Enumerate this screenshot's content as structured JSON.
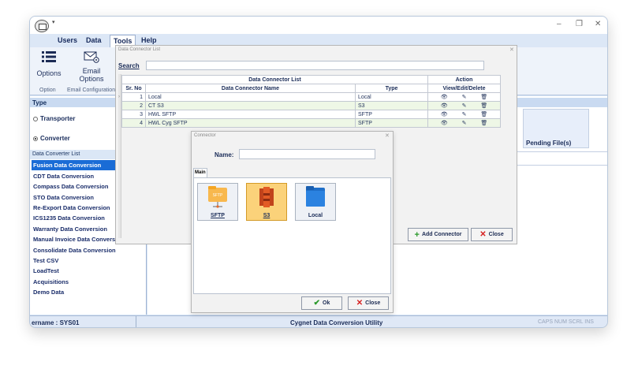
{
  "window": {
    "controls": [
      "–",
      "❐",
      "✕"
    ],
    "quick_access": "▾"
  },
  "menu": {
    "items": [
      "Users",
      "Data",
      "Tools",
      "Help"
    ],
    "active": "Tools"
  },
  "ribbon": {
    "options_label": "Options",
    "email_label_1": "Email",
    "email_label_2": "Options",
    "group_option": "Option",
    "group_email": "Email Configuration"
  },
  "left": {
    "type_header": "Type",
    "radio_transporter": "Transporter",
    "radio_converter": "Converter",
    "list_header": "Data Converter List",
    "items": [
      "Fusion Data Conversion",
      "CDT Data Conversion",
      "Compass Data Conversion",
      "STO Data Conversion",
      "Re-Export Data Conversion",
      "ICS1235 Data Conversion",
      "Warranty Data Conversion",
      "Manual Invoice Data Conversion",
      "Consolidate Data Conversion",
      "Test CSV",
      "LoadTest",
      "Acquisitions",
      "Demo Data"
    ]
  },
  "right": {
    "pending_label": "Pending File(s)"
  },
  "status": {
    "username": "ername : SYS01",
    "center": "Cygnet Data Conversion Utility",
    "keys": "CAPS  NUM  SCRL  INS"
  },
  "dc_list": {
    "title": "Data Connector List",
    "search_label": "Search",
    "search_value": "",
    "table_title": "Data Connector List",
    "action_title": "Action",
    "headers": [
      "Sr. No",
      "Data Connector Name",
      "Type",
      "View/Edit/Delete"
    ],
    "rows": [
      {
        "no": "1",
        "name": "Local",
        "type": "Local"
      },
      {
        "no": "2",
        "name": "CT S3",
        "type": "S3"
      },
      {
        "no": "3",
        "name": "HWL SFTP",
        "type": "SFTP"
      },
      {
        "no": "4",
        "name": "HWL Cyg SFTP",
        "type": "SFTP"
      }
    ],
    "add_label": "Add Connector",
    "close_label": "Close"
  },
  "connector": {
    "title": "Connector",
    "name_label": "Name:",
    "name_value": "",
    "tab_main": "Main",
    "tiles": [
      {
        "label": "SFTP",
        "icon": "sftp-folder-icon",
        "selected": false
      },
      {
        "label": "S3",
        "icon": "s3-bucket-icon",
        "selected": true
      },
      {
        "label": "Local",
        "icon": "local-folder-icon",
        "selected": false
      }
    ],
    "ok_label": "Ok",
    "close_label": "Close"
  }
}
